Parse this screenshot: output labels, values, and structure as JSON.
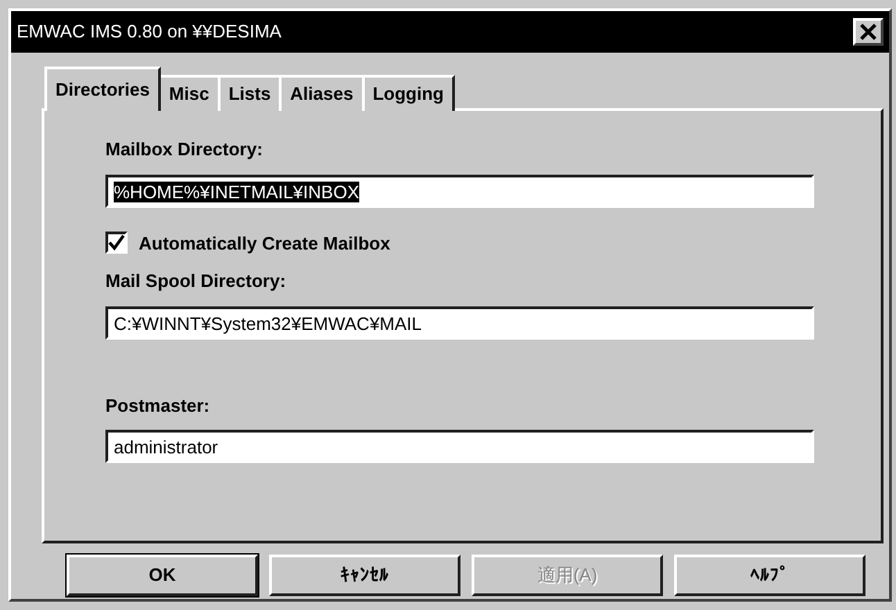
{
  "window": {
    "title": "EMWAC IMS 0.80 on ¥¥DESIMA"
  },
  "tabs": [
    {
      "label": "Directories",
      "selected": true
    },
    {
      "label": "Misc",
      "selected": false
    },
    {
      "label": "Lists",
      "selected": false
    },
    {
      "label": "Aliases",
      "selected": false
    },
    {
      "label": "Logging",
      "selected": false
    }
  ],
  "fields": [
    {
      "kind": "text",
      "label": "Mailbox Directory:",
      "value": "%HOME%¥INETMAIL¥INBOX",
      "selected": true
    },
    {
      "kind": "checkbox",
      "label": "Automatically Create Mailbox",
      "checked": true
    },
    {
      "kind": "text",
      "label": "Mail Spool Directory:",
      "value": "C:¥WINNT¥System32¥EMWAC¥MAIL",
      "selected": false
    },
    {
      "kind": "text",
      "label": "Postmaster:",
      "value": "administrator",
      "selected": false
    }
  ],
  "buttons": [
    {
      "label": "OK",
      "disabled": false,
      "default": true
    },
    {
      "label": "ｷｬﾝｾﾙ",
      "disabled": false,
      "default": false
    },
    {
      "label": "適用(A)",
      "disabled": true,
      "default": false
    },
    {
      "label": "ﾍﾙﾌﾟ",
      "disabled": false,
      "default": false
    }
  ]
}
